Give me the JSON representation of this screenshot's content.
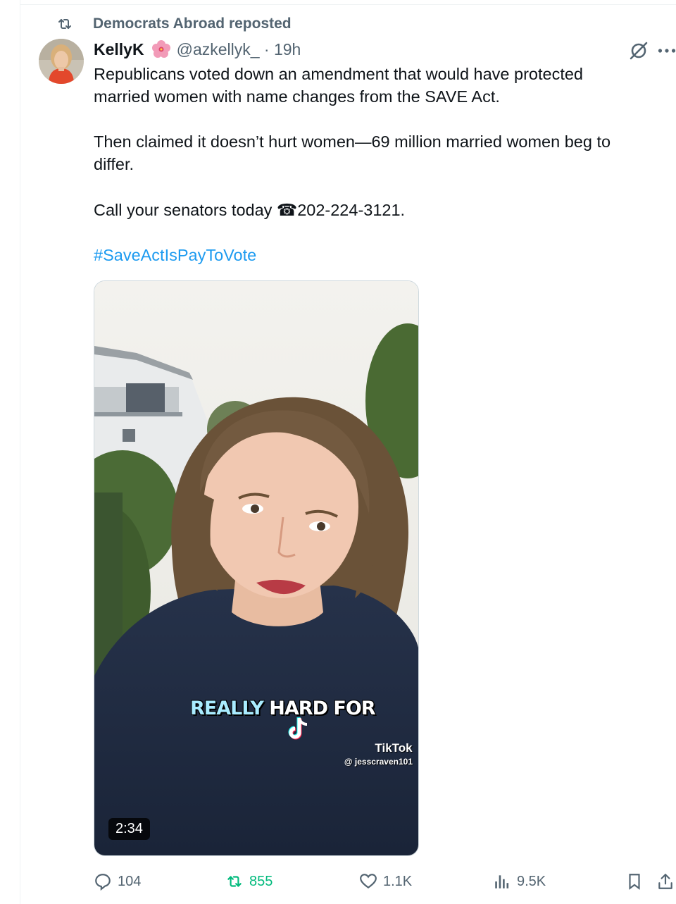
{
  "repost_banner": {
    "text": "Democrats Abroad reposted",
    "icon": "repost-icon"
  },
  "tweet": {
    "author_name": "KellyK",
    "author_emoji": "hibiscus",
    "handle_time": "@azkellyk_ · 19h",
    "text_lines": [
      "Republicans voted down an amendment that would have protected",
      "married women with name changes from the SAVE Act.",
      "Then claimed it doesn’t hurt women—69 million married women beg to",
      "differ.",
      " Call your senators today ☎202-224-3121."
    ],
    "hashtag": "#SaveActIsPayToVote"
  },
  "video": {
    "caption_word1": "REALLY",
    "caption_word2": " HARD FOR",
    "watermark_brand": "TikTok",
    "watermark_handle": "@ jesscraven101",
    "duration": "2:34"
  },
  "actions": {
    "replies": "104",
    "reposts": "855",
    "likes": "1.1K",
    "views": "9.5K"
  },
  "colors": {
    "text_primary": "#0f1419",
    "text_secondary": "#536471",
    "link": "#1d9bf0",
    "repost_green": "#00ba7c",
    "border": "#cfd9de"
  }
}
